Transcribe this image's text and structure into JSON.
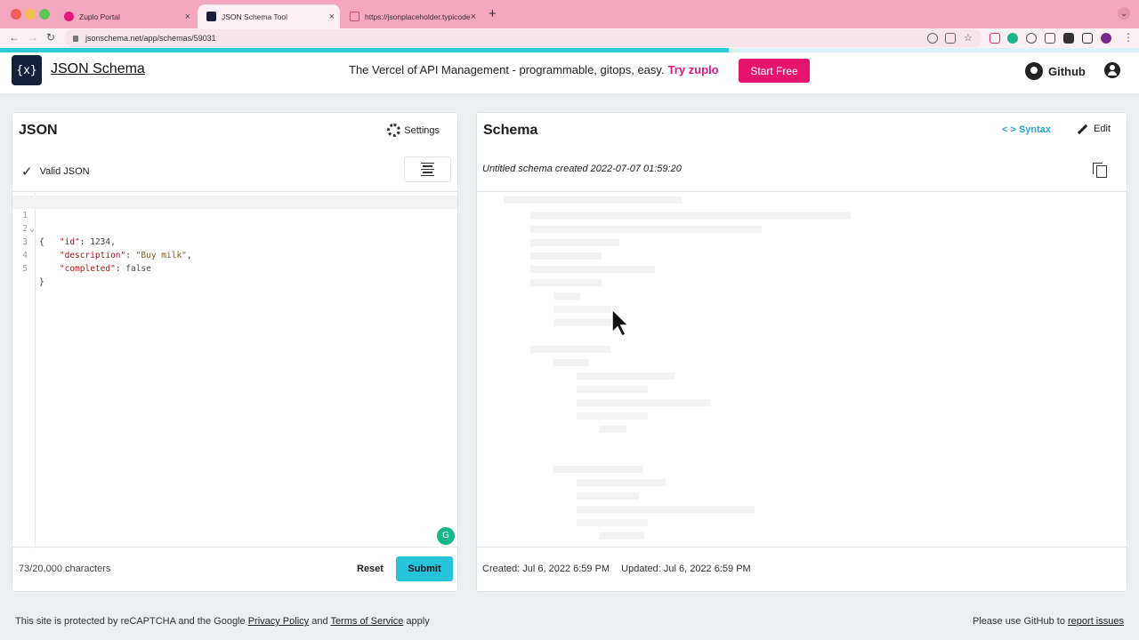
{
  "browser": {
    "tabs": [
      {
        "label": "Zuplo Portal",
        "favicon_color": "#e1177e"
      },
      {
        "label": "JSON Schema Tool",
        "favicon_color": "#15203a"
      },
      {
        "label": "https://jsonplaceholder.typicode",
        "favicon_color": "#d24b77"
      }
    ],
    "new_tab": "+",
    "url": "jsonschema.net/app/schemas/59031",
    "page_load_progress": 0.64
  },
  "header": {
    "logo_text": "{x}",
    "brand": "JSON Schema",
    "promo_text": "The Vercel of API Management - programmable, gitops, easy.",
    "promo_link": "Try zuplo",
    "start_button": "Start Free",
    "github_label": "Github"
  },
  "json_panel": {
    "title": "JSON",
    "settings_label": "Settings",
    "valid_label": "Valid JSON",
    "lines": [
      {
        "no": "1",
        "fold": "⌄"
      },
      {
        "no": "2"
      },
      {
        "no": "3"
      },
      {
        "no": "4"
      },
      {
        "no": "5"
      }
    ],
    "code": {
      "l1": "{",
      "id_key": "\"id\"",
      "id_val": "1234",
      "desc_key": "\"description\"",
      "desc_val": "\"Buy milk\"",
      "comp_key": "\"completed\"",
      "comp_val": "false",
      "l5": "}"
    },
    "char_count": "73/20,000 characters",
    "reset_label": "Reset",
    "submit_label": "Submit"
  },
  "schema_panel": {
    "title": "Schema",
    "syntax_label": "Syntax",
    "edit_label": "Edit",
    "schema_name": "Untitled schema created 2022-07-07 01:59:20",
    "created": "Created: Jul 6, 2022 6:59 PM",
    "updated": "Updated: Jul 6, 2022 6:59 PM"
  },
  "footer": {
    "text_before": "This site is protected by reCAPTCHA and the Google",
    "privacy": "Privacy Policy",
    "and": "and",
    "terms": "Terms of Service",
    "apply": "apply",
    "github_text": "Please use GitHub to",
    "report": "report issues"
  },
  "colors": {
    "accent": "#26c4db",
    "brand_pink": "#e6146f",
    "tab_bar": "#f5a7c0"
  }
}
